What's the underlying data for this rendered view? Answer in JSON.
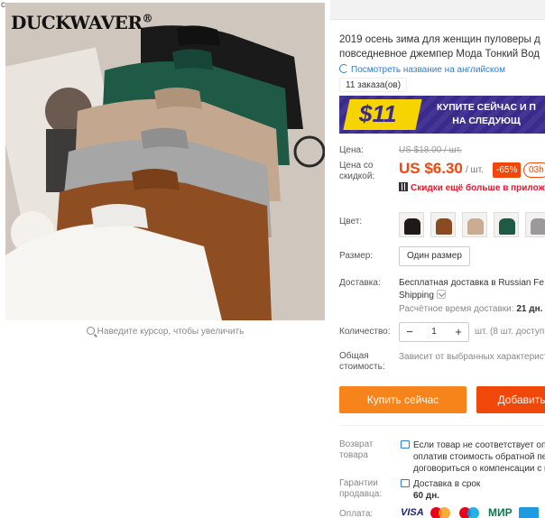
{
  "left": {
    "stray_char": "c",
    "brand": "DUCKWAVER",
    "brand_mark": "®",
    "zoom_hint": "Наведите курсор, чтобы увеличить"
  },
  "product": {
    "title_line1": "2019 осень зима для женщин пуловеры д",
    "title_line2": "повседневное джемпер Мода Тонкий Вод",
    "translate_link": "Посмотреть название на английском",
    "orders": "11 заказа(ов)"
  },
  "banner": {
    "amount": "$11",
    "promo_line1": "КУПИТЕ СЕЙЧАС И П",
    "promo_line2": "НА СЛЕДУЮЩ"
  },
  "price": {
    "label": "Цена:",
    "discount_label_line1": "Цена со",
    "discount_label_line2": "скидкой:",
    "old": "US $18.00 / шт.",
    "current": "US $6.30",
    "unit": "/ шт.",
    "discount": "-65%",
    "timer": "03h",
    "app_discount": "Скидки ещё больше в приложен"
  },
  "options": {
    "color_label": "Цвет:",
    "color_swatches": [
      "#1f1a17",
      "#8a4b22",
      "#c9ad93",
      "#1f5a47",
      "#9a9a9a"
    ],
    "size_label": "Размер:",
    "size_value": "Один размер"
  },
  "shipping": {
    "label": "Доставка:",
    "line1": "Бесплатная доставка в Russian Fe",
    "line2": "Shipping",
    "time_prefix": "Расчётное время доставки:",
    "time_value": "21 дн."
  },
  "quantity": {
    "label": "Количество:",
    "minus": "−",
    "value": "1",
    "plus": "+",
    "note": "шт. (8 шт. доступно"
  },
  "total": {
    "label_line1": "Общая",
    "label_line2": "стоимость:",
    "value": "Зависит от выбранных характерист"
  },
  "actions": {
    "buy": "Купить сейчас",
    "add": "Добавить"
  },
  "guarantees": {
    "return_label_line1": "Возврат",
    "return_label_line2": "товара",
    "return_line1": "Если товар не соответствует опи",
    "return_line2": "оплатив стоимость обратной пе",
    "return_line3": "договориться о компенсации с п",
    "seller_label_line1": "Гарантии",
    "seller_label_line2": "продавца:",
    "seller_line1": "Доставка в срок",
    "seller_line2": "60 дн.",
    "payment_label": "Оплата:",
    "payment_visa": "VISA",
    "payment_mir": "МИР"
  }
}
